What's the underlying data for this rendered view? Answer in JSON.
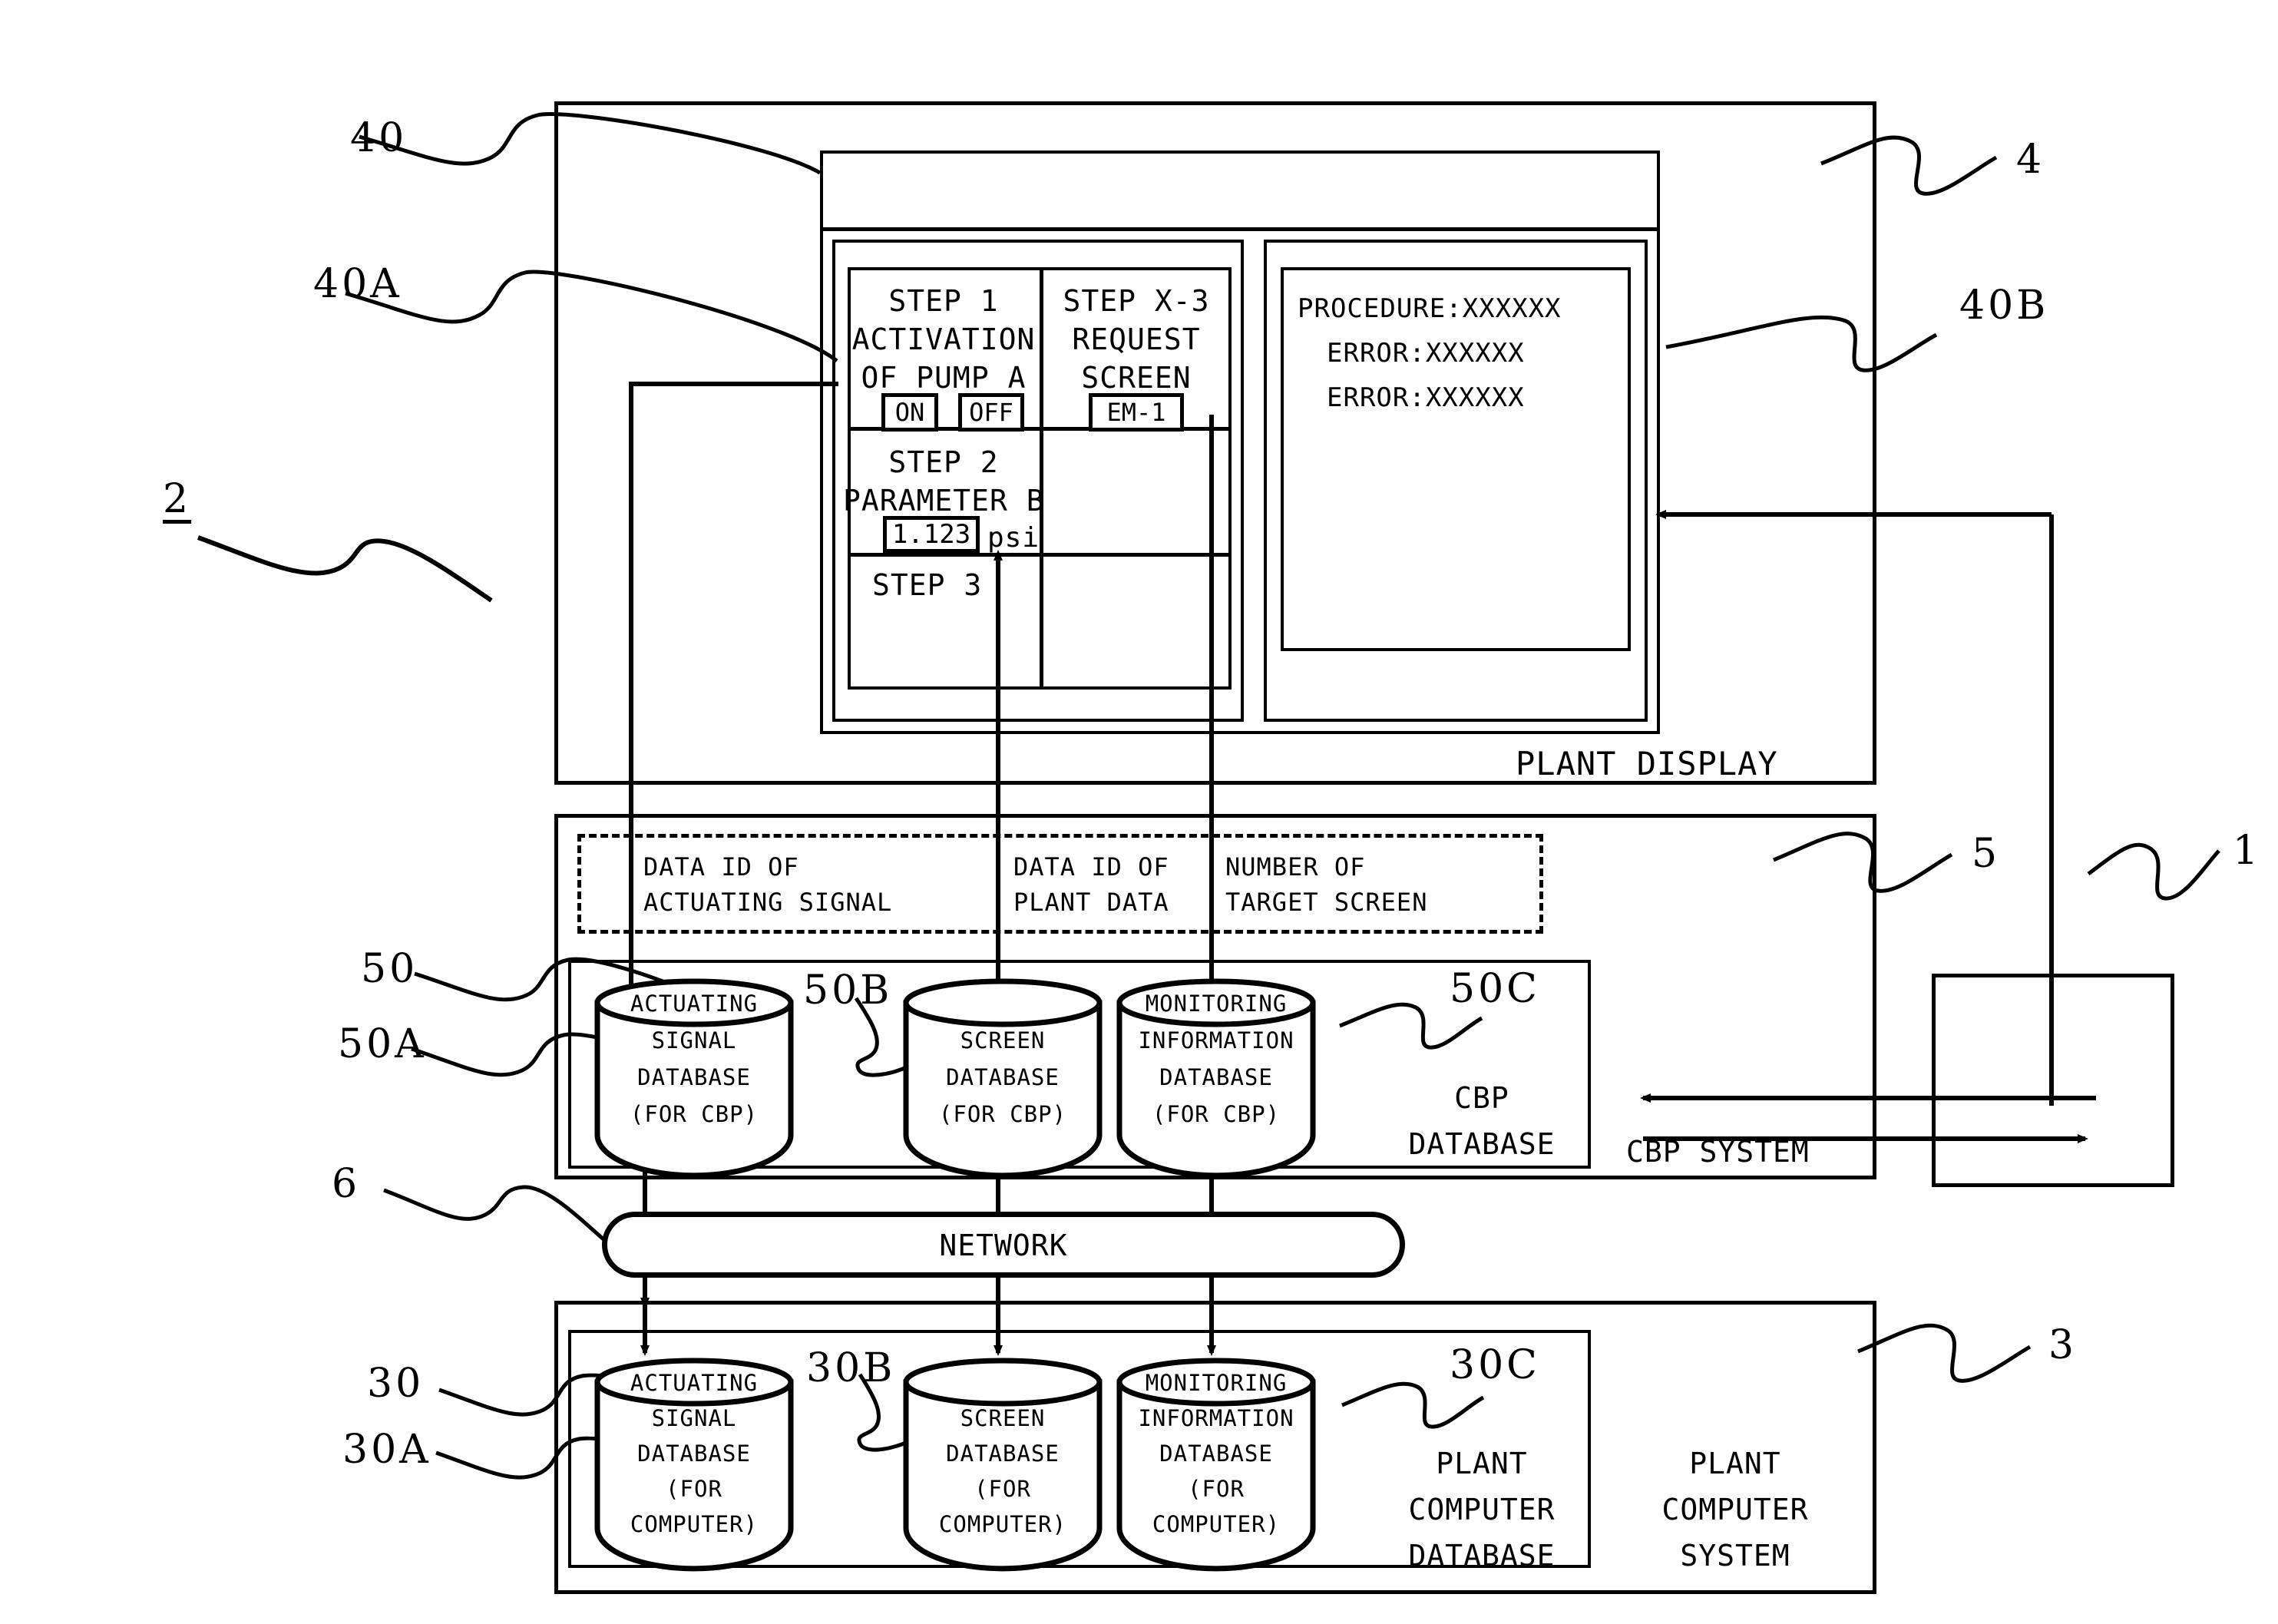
{
  "figure": {
    "plant_display": {
      "caption": "PLANT DISPLAY",
      "refs": {
        "outer": "4",
        "window": "40",
        "left_panel": "40A",
        "right_panel": "40B"
      },
      "procedure_panel": {
        "steps": [
          {
            "title": "STEP 1",
            "line2": "ACTIVATION",
            "line3": "OF PUMP A",
            "buttons": [
              "ON",
              "OFF"
            ]
          },
          {
            "title": "STEP 2",
            "line2": "PARAMETER B",
            "value": "1.123",
            "unit": "psi"
          },
          {
            "title": "STEP 3",
            "line2": "",
            "value": "",
            "unit": ""
          }
        ],
        "side_step": {
          "title": "STEP X-3",
          "line2": "REQUEST",
          "line3": "SCREEN",
          "button": "EM-1"
        }
      },
      "monitor_panel": {
        "lines": [
          "PROCEDURE:XXXXXX",
          "ERROR:XXXXXX",
          "ERROR:XXXXXX"
        ]
      }
    },
    "cbp_system": {
      "caption": "CBP SYSTEM",
      "database_caption_line1": "CBP",
      "database_caption_line2": "DATABASE",
      "refs": {
        "system": "5",
        "db_group": "50",
        "db_a": "50A",
        "db_b": "50B",
        "db_c": "50C"
      },
      "signal_labels": [
        {
          "line1": "DATA ID OF",
          "line2": "ACTUATING SIGNAL"
        },
        {
          "line1": "DATA ID OF",
          "line2": "PLANT DATA"
        },
        {
          "line1": "NUMBER OF",
          "line2": "TARGET SCREEN"
        }
      ],
      "databases": [
        {
          "lines": [
            "ACTUATING",
            "SIGNAL",
            "DATABASE",
            "(FOR CBP)"
          ]
        },
        {
          "lines": [
            "",
            "SCREEN",
            "DATABASE",
            "(FOR CBP)"
          ]
        },
        {
          "lines": [
            "MONITORING",
            "INFORMATION",
            "DATABASE",
            "(FOR CBP)"
          ]
        }
      ]
    },
    "network": {
      "label": "NETWORK",
      "ref": "6"
    },
    "plant_computer_system": {
      "caption_lines": [
        "PLANT",
        "COMPUTER",
        "SYSTEM"
      ],
      "database_caption_lines": [
        "PLANT",
        "COMPUTER",
        "DATABASE"
      ],
      "refs": {
        "system": "3",
        "db_group": "30",
        "db_a": "30A",
        "db_b": "30B",
        "db_c": "30C"
      },
      "databases": [
        {
          "lines": [
            "ACTUATING",
            "SIGNAL",
            "DATABASE",
            "(FOR",
            "COMPUTER)"
          ]
        },
        {
          "lines": [
            "",
            "SCREEN",
            "DATABASE",
            "(FOR",
            "COMPUTER)"
          ]
        },
        {
          "lines": [
            "MONITORING",
            "INFORMATION",
            "DATABASE",
            "(FOR",
            "COMPUTER)"
          ]
        }
      ]
    },
    "external_unit": {
      "ref": "1",
      "label": ""
    },
    "assembly_ref": "2"
  }
}
